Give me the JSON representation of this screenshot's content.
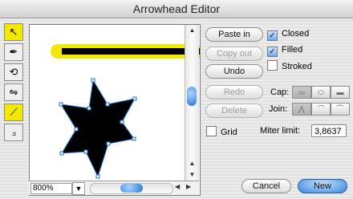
{
  "window": {
    "title": "Arrowhead Editor"
  },
  "tools": [
    {
      "name": "select-tool",
      "glyph": "↖",
      "active": true
    },
    {
      "name": "pen-tool",
      "glyph": "✒",
      "active": false
    },
    {
      "name": "rotate-tool",
      "glyph": "⟲",
      "active": false
    },
    {
      "name": "flip-tool",
      "glyph": "⇋",
      "active": false
    },
    {
      "name": "line-tool",
      "glyph": "⟋",
      "active": true
    },
    {
      "name": "shape-tool",
      "glyph": "⟓",
      "active": false
    }
  ],
  "canvas": {
    "zoom": "800%",
    "line_highlight_color": "#f3e800",
    "handle_color": "#1a6fcf"
  },
  "buttons": {
    "paste_in": "Paste in",
    "copy_out": "Copy out",
    "undo": "Undo",
    "redo": "Redo",
    "delete": "Delete",
    "cancel": "Cancel",
    "new": "New"
  },
  "options": {
    "closed_label": "Closed",
    "closed_checked": true,
    "filled_label": "Filled",
    "filled_checked": true,
    "stroked_label": "Stroked",
    "stroked_checked": false,
    "grid_label": "Grid",
    "grid_checked": false
  },
  "cap": {
    "label": "Cap:",
    "options": [
      "butt-cap-icon",
      "round-cap-icon",
      "square-cap-icon"
    ]
  },
  "join": {
    "label": "Join:",
    "options": [
      "miter-join-icon",
      "round-join-icon",
      "bevel-join-icon"
    ]
  },
  "miter": {
    "label": "Miter limit:",
    "value": "3,8637"
  }
}
